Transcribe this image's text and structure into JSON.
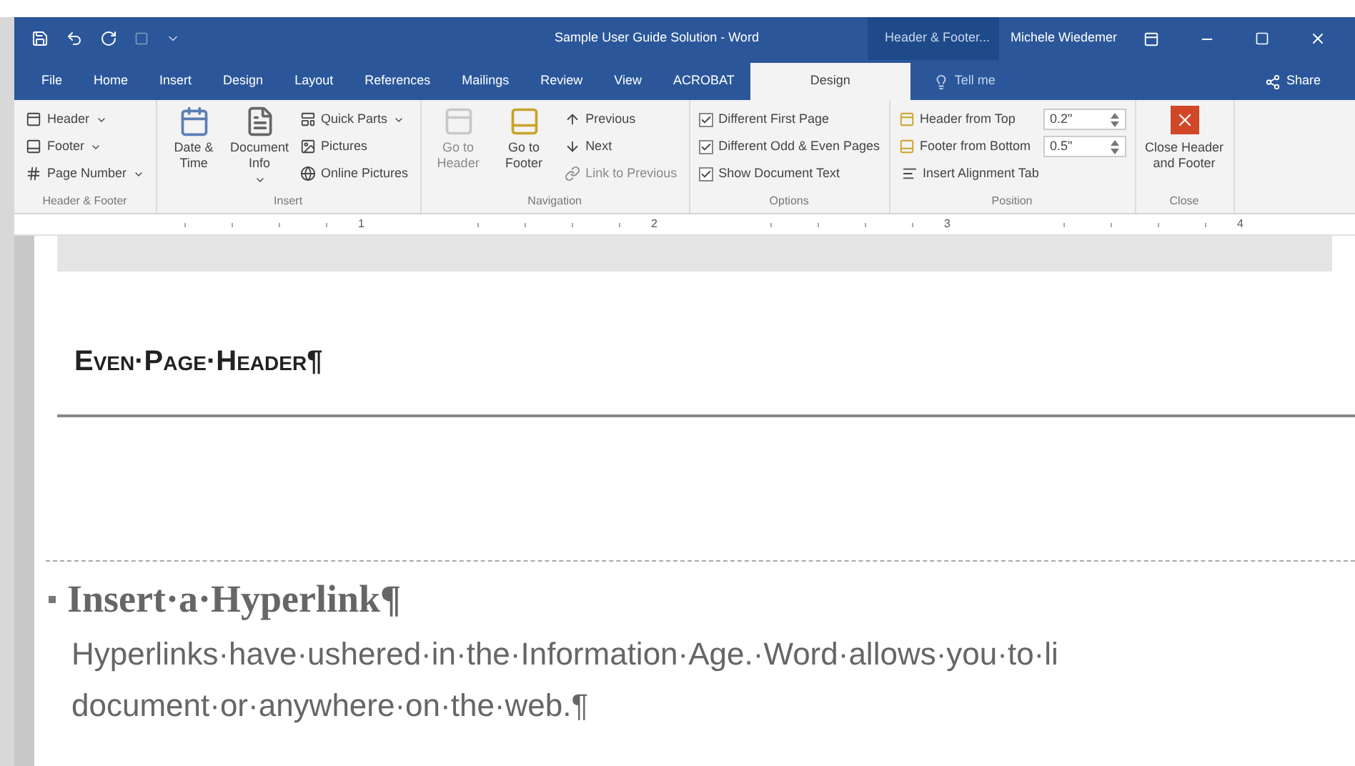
{
  "window": {
    "title": "Sample User Guide Solution - Word",
    "context_tab": "Header & Footer...",
    "user": "Michele Wiedemer"
  },
  "tabs": [
    {
      "label": "File",
      "selected": false
    },
    {
      "label": "Home",
      "selected": false
    },
    {
      "label": "Insert",
      "selected": false
    },
    {
      "label": "Design",
      "selected": false
    },
    {
      "label": "Layout",
      "selected": false
    },
    {
      "label": "References",
      "selected": false
    },
    {
      "label": "Mailings",
      "selected": false
    },
    {
      "label": "Review",
      "selected": false
    },
    {
      "label": "View",
      "selected": false
    },
    {
      "label": "ACROBAT",
      "selected": false
    },
    {
      "label": "Design",
      "selected": true
    }
  ],
  "tell_me": "Tell me",
  "share": "Share",
  "ribbon": [
    {
      "label": "Header & Footer",
      "items": [
        {
          "kind": "small",
          "label": "Header",
          "dropdown": true,
          "disabled": false
        },
        {
          "kind": "small",
          "label": "Footer",
          "dropdown": true,
          "disabled": false
        },
        {
          "kind": "small",
          "label": "Page Number",
          "dropdown": true,
          "disabled": false
        }
      ]
    },
    {
      "label": "Insert",
      "items": [
        {
          "kind": "large",
          "label": "Date & Time",
          "dropdown": false,
          "disabled": false
        },
        {
          "kind": "large",
          "label": "Document Info",
          "dropdown": true,
          "disabled": false
        },
        {
          "kind": "small",
          "label": "Quick Parts",
          "dropdown": true,
          "disabled": false
        },
        {
          "kind": "small",
          "label": "Pictures",
          "dropdown": false,
          "disabled": false
        },
        {
          "kind": "small",
          "label": "Online Pictures",
          "dropdown": false,
          "disabled": false
        }
      ]
    },
    {
      "label": "Navigation",
      "items": [
        {
          "kind": "large",
          "label": "Go to Header",
          "dropdown": false,
          "disabled": true
        },
        {
          "kind": "large",
          "label": "Go to Footer",
          "dropdown": false,
          "disabled": false
        },
        {
          "kind": "small",
          "label": "Previous",
          "dropdown": false,
          "disabled": false
        },
        {
          "kind": "small",
          "label": "Next",
          "dropdown": false,
          "disabled": false
        },
        {
          "kind": "small",
          "label": "Link to Previous",
          "dropdown": false,
          "disabled": true
        }
      ]
    },
    {
      "label": "Options",
      "items": [
        {
          "kind": "checkbox",
          "label": "Different First Page",
          "checked": true
        },
        {
          "kind": "checkbox",
          "label": "Different Odd & Even Pages",
          "checked": true
        },
        {
          "kind": "checkbox",
          "label": "Show Document Text",
          "checked": true
        }
      ]
    },
    {
      "label": "Position",
      "items": [
        {
          "kind": "spin",
          "label": "Header from Top",
          "value": "0.2\""
        },
        {
          "kind": "spin",
          "label": "Footer from Bottom",
          "value": "0.5\""
        },
        {
          "kind": "small",
          "label": "Insert Alignment Tab",
          "dropdown": false,
          "disabled": false
        }
      ]
    },
    {
      "label": "Close",
      "items": [
        {
          "kind": "close",
          "label": "Close Header and Footer"
        }
      ]
    }
  ],
  "ruler": [
    "1",
    "2",
    "3",
    "4"
  ],
  "document": {
    "header_label": "Even·Page·Header¶",
    "heading": "Insert·a·Hyperlink¶",
    "paragraph_lines": [
      "Hyperlinks·have·ushered·in·the·Information·Age.·Word·allows·you·to·li",
      "document·or·anywhere·on·the·web.¶"
    ]
  }
}
